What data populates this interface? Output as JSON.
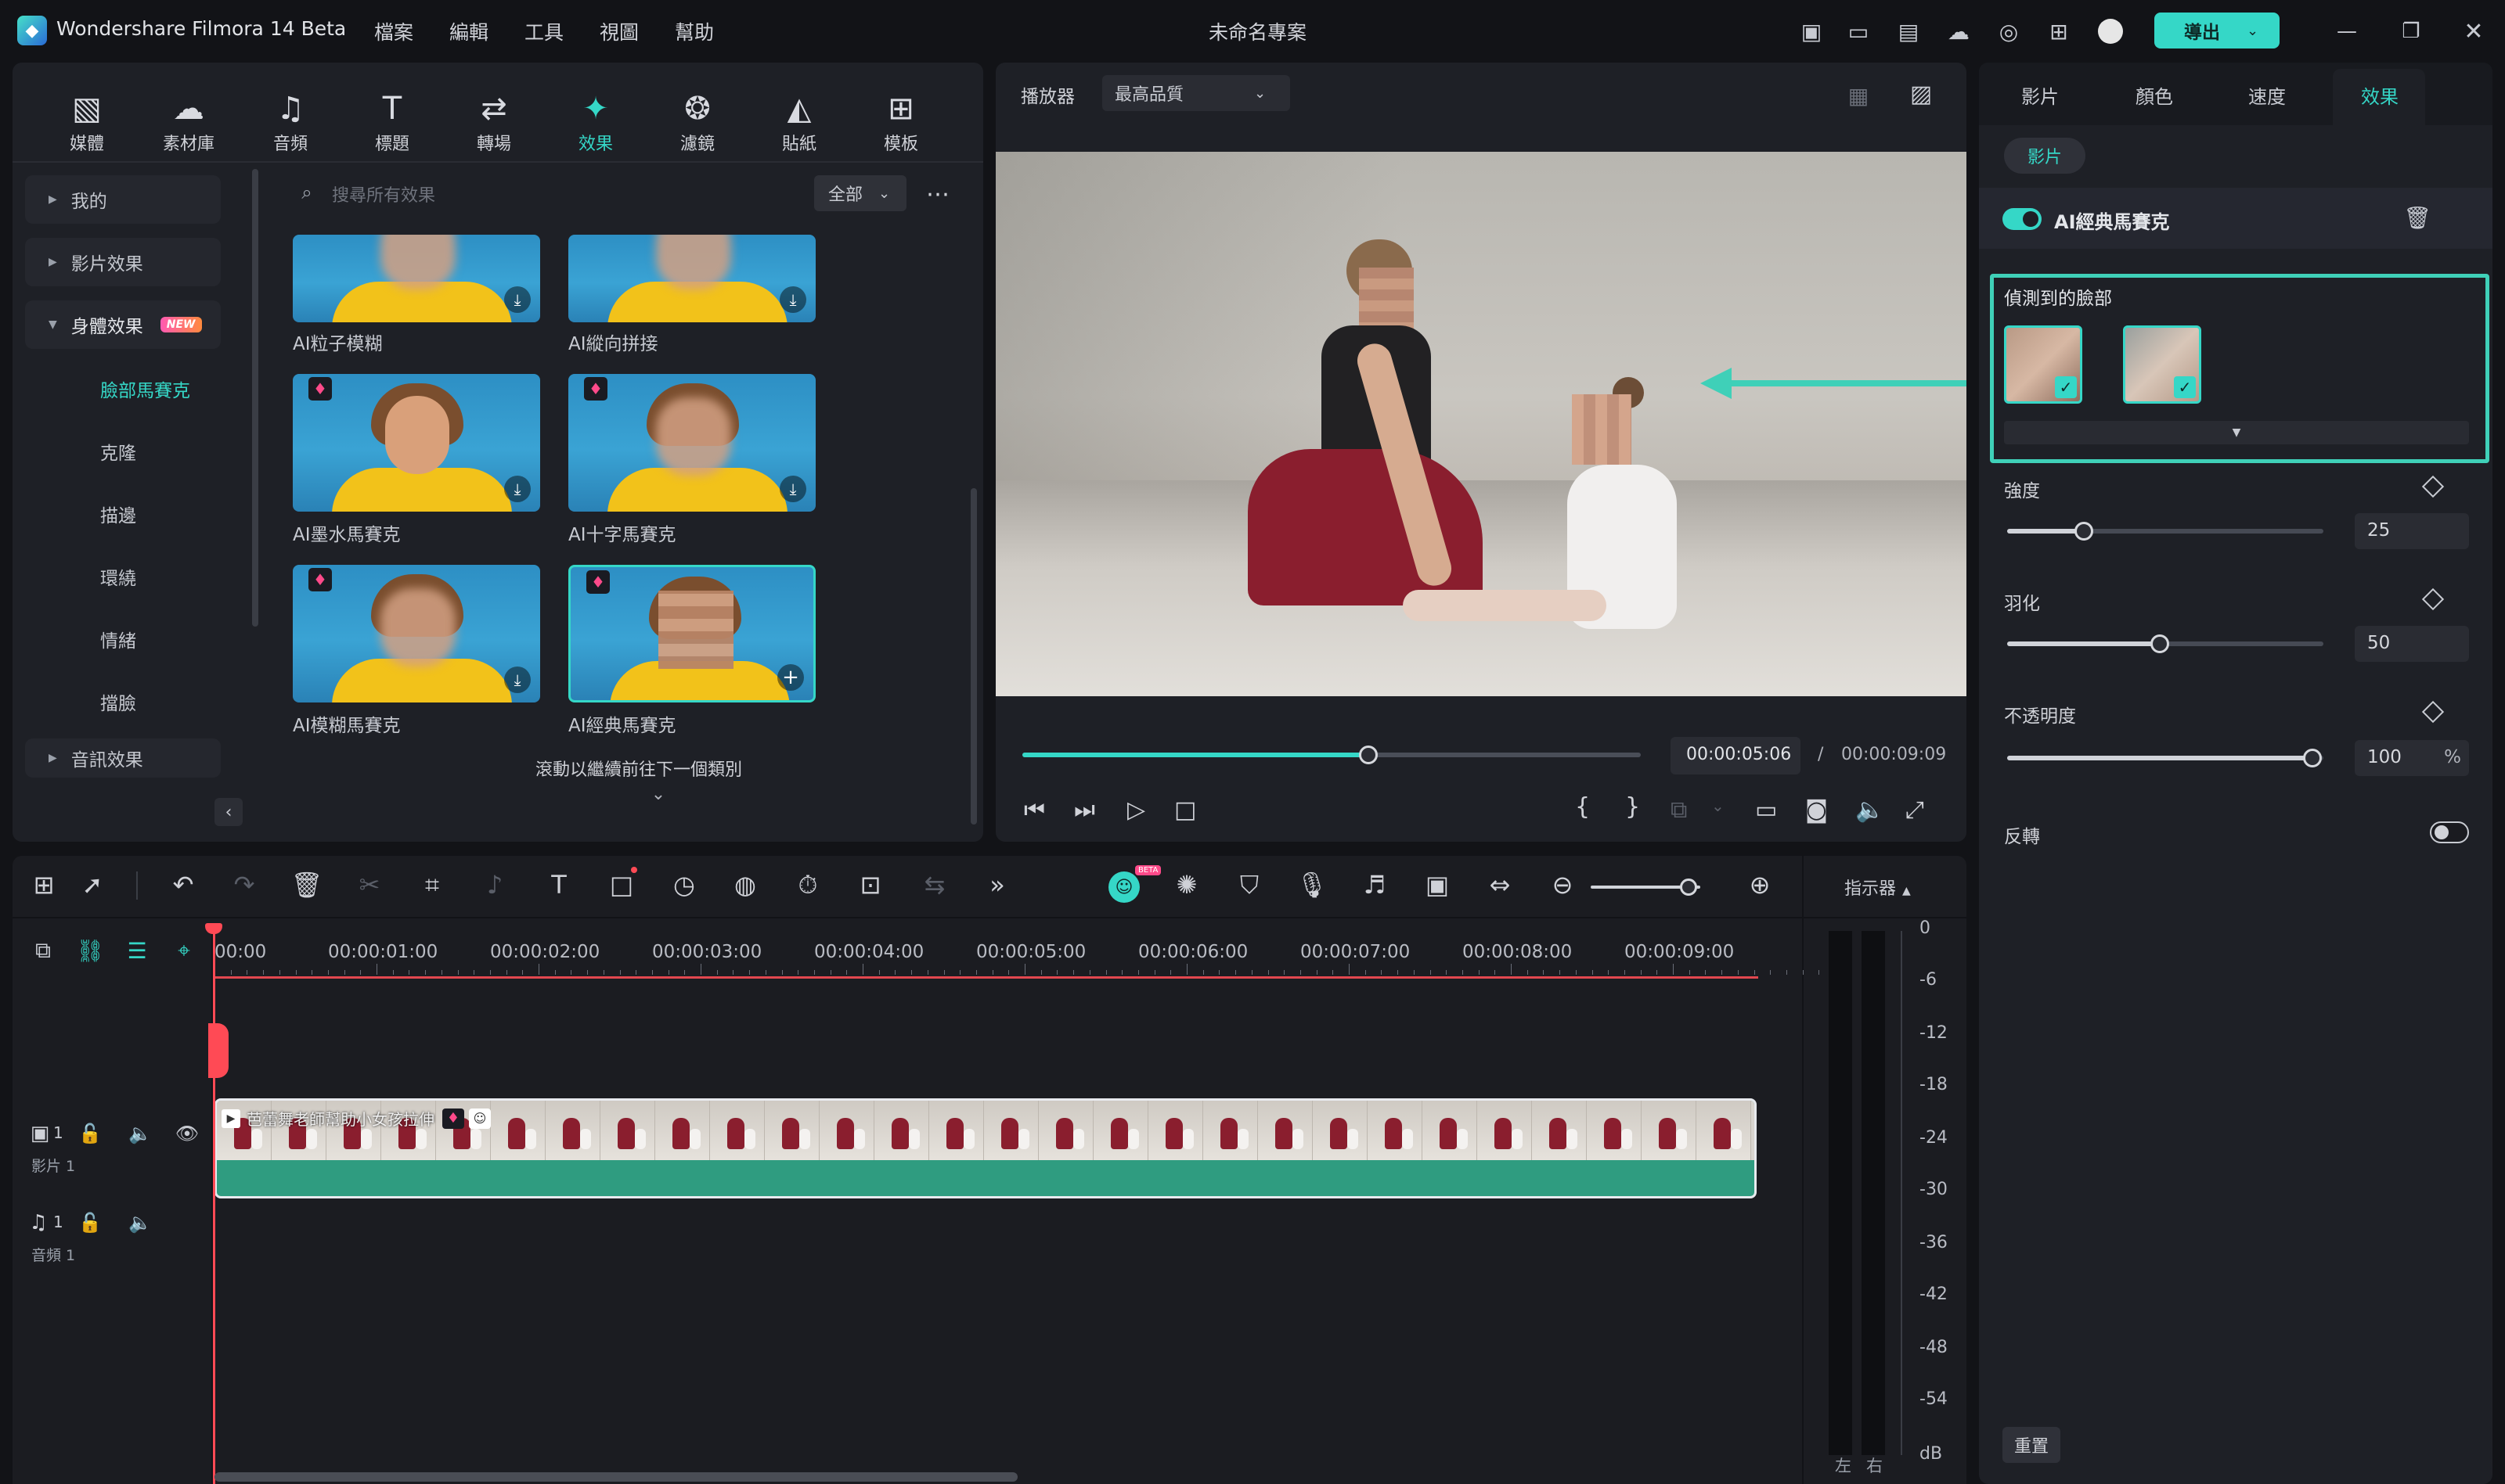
{
  "app": {
    "name": "Wondershare Filmora 14 Beta",
    "project_title": "未命名專案",
    "export_label": "導出"
  },
  "menu": [
    "檔案",
    "編輯",
    "工具",
    "視圖",
    "幫助"
  ],
  "toolbar": [
    {
      "label": "媒體",
      "icon": "media-icon"
    },
    {
      "label": "素材庫",
      "icon": "stock-library-icon"
    },
    {
      "label": "音頻",
      "icon": "audio-icon"
    },
    {
      "label": "標題",
      "icon": "title-icon"
    },
    {
      "label": "轉場",
      "icon": "transition-icon"
    },
    {
      "label": "效果",
      "icon": "effects-icon"
    },
    {
      "label": "濾鏡",
      "icon": "filter-icon"
    },
    {
      "label": "貼紙",
      "icon": "sticker-icon"
    },
    {
      "label": "模板",
      "icon": "template-icon"
    }
  ],
  "sidebar": {
    "categories": [
      {
        "label": "我的"
      },
      {
        "label": "影片效果"
      },
      {
        "label": "身體效果",
        "badge": "NEW"
      },
      {
        "label": "音訊效果"
      }
    ],
    "subcategories": [
      "臉部馬賽克",
      "克隆",
      "描邊",
      "環繞",
      "情緒",
      "擋臉"
    ]
  },
  "search": {
    "placeholder": "搜尋所有效果",
    "filter": "全部"
  },
  "effects": [
    {
      "label": "AI粒子模糊"
    },
    {
      "label": "AI縱向拼接"
    },
    {
      "label": "AI墨水馬賽克"
    },
    {
      "label": "AI十字馬賽克"
    },
    {
      "label": "AI模糊馬賽克"
    },
    {
      "label": "AI經典馬賽克"
    }
  ],
  "scroll_hint": "滾動以繼續前往下一個類別",
  "player": {
    "label": "播放器",
    "quality": "最高品質",
    "current_time": "00:00:05:06",
    "separator": "/",
    "total_time": "00:00:09:09",
    "progress": 0.56
  },
  "inspector": {
    "tabs": [
      "影片",
      "顏色",
      "速度",
      "效果"
    ],
    "active_tab": "效果",
    "chip": "影片",
    "effect_name": "AI經典馬賽克",
    "detected_faces_label": "偵測到的臉部",
    "params": [
      {
        "label": "強度",
        "value": "25",
        "fraction": 0.25
      },
      {
        "label": "羽化",
        "value": "50",
        "fraction": 0.5
      },
      {
        "label": "不透明度",
        "value": "100",
        "unit": "%",
        "fraction": 1.0
      }
    ],
    "invert_label": "反轉",
    "reset_label": "重置"
  },
  "timeline": {
    "ruler": [
      "00:00",
      "00:00:01:00",
      "00:00:02:00",
      "00:00:03:00",
      "00:00:04:00",
      "00:00:05:00",
      "00:00:06:00",
      "00:00:07:00",
      "00:00:08:00",
      "00:00:09:00"
    ],
    "video_track": {
      "number": "1",
      "name": "影片 1"
    },
    "audio_track": {
      "number": "1",
      "name": "音頻 1"
    },
    "clip_title": "芭蕾舞老師幫助小女孩拉伸",
    "indicator_label": "指示器",
    "meter_scale": [
      "0",
      "-6",
      "-12",
      "-18",
      "-24",
      "-30",
      "-36",
      "-42",
      "-48",
      "-54",
      "dB"
    ],
    "meter_channels": [
      "左",
      "右"
    ],
    "beta_badge": "BETA"
  },
  "colors": {
    "accent": "#35d7c7",
    "playhead": "#ff4a55",
    "clip": "#2f9c80",
    "premium": "#ff4a8a"
  }
}
